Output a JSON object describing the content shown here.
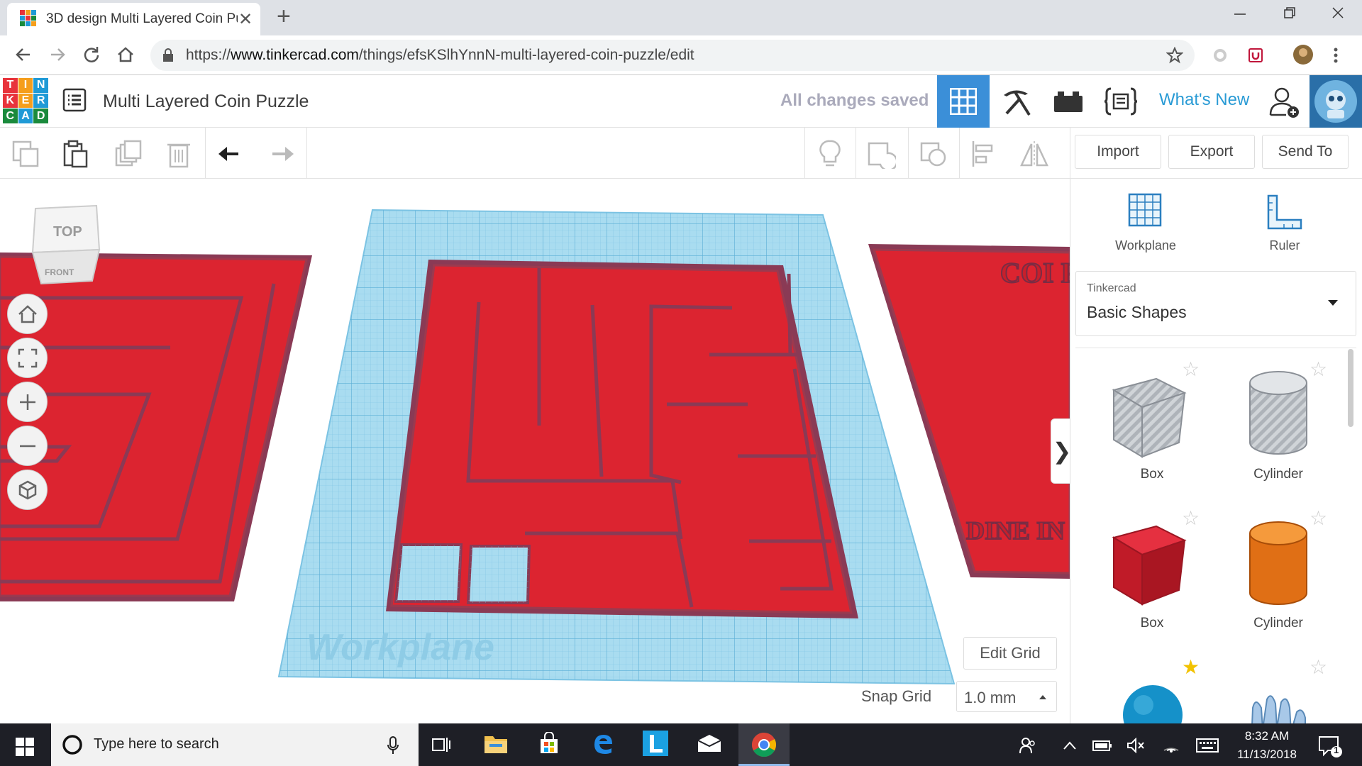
{
  "browser": {
    "tab_title": "3D design Multi Layered Coin Pu",
    "tab_close": "✕",
    "new_tab": "+",
    "url_prefix": "https://",
    "url_host": "www.tinkercad.com",
    "url_path": "/things/efsKSlhYnnN-multi-layered-coin-puzzle/edit"
  },
  "app": {
    "logo_letters": [
      "T",
      "I",
      "N",
      "K",
      "E",
      "R",
      "C",
      "A",
      "D"
    ],
    "logo_colors": [
      "#e8333b",
      "#f59e1c",
      "#1f9ad6",
      "#e8333b",
      "#f59e1c",
      "#1f9ad6",
      "#1a8a3c",
      "#1f9ad6",
      "#1a8a3c"
    ],
    "design_title": "Multi Layered Coin Puzzle",
    "save_status": "All changes saved",
    "whats_new": "What's New"
  },
  "toolbar": {
    "import_label": "Import",
    "export_label": "Export",
    "send_to_label": "Send To"
  },
  "viewcube": {
    "top": "TOP",
    "front": "FRONT"
  },
  "workspace": {
    "workplane_watermark": "Workplane",
    "edit_grid": "Edit Grid",
    "snap_grid_label": "Snap Grid",
    "snap_grid_value": "1.0 mm",
    "right_object_text_top": "COI PUZ",
    "right_object_text_bottom": "DINE IN"
  },
  "panel": {
    "workplane_label": "Workplane",
    "ruler_label": "Ruler",
    "library_small": "Tinkercad",
    "library_name": "Basic Shapes",
    "shapes": [
      {
        "label": "Box",
        "favorite": false
      },
      {
        "label": "Cylinder",
        "favorite": false
      },
      {
        "label": "Box",
        "favorite": false
      },
      {
        "label": "Cylinder",
        "favorite": false
      },
      {
        "label": "",
        "favorite": true
      },
      {
        "label": "",
        "favorite": false
      }
    ]
  },
  "colors": {
    "puzzle_red": "#dc2430",
    "puzzle_edge": "#8a3a55",
    "workplane_blue": "#a9dcf0",
    "accent_blue": "#2a9bd5"
  },
  "taskbar": {
    "search_placeholder": "Type here to search",
    "time": "8:32 AM",
    "date": "11/13/2018",
    "notification_count": "1"
  }
}
